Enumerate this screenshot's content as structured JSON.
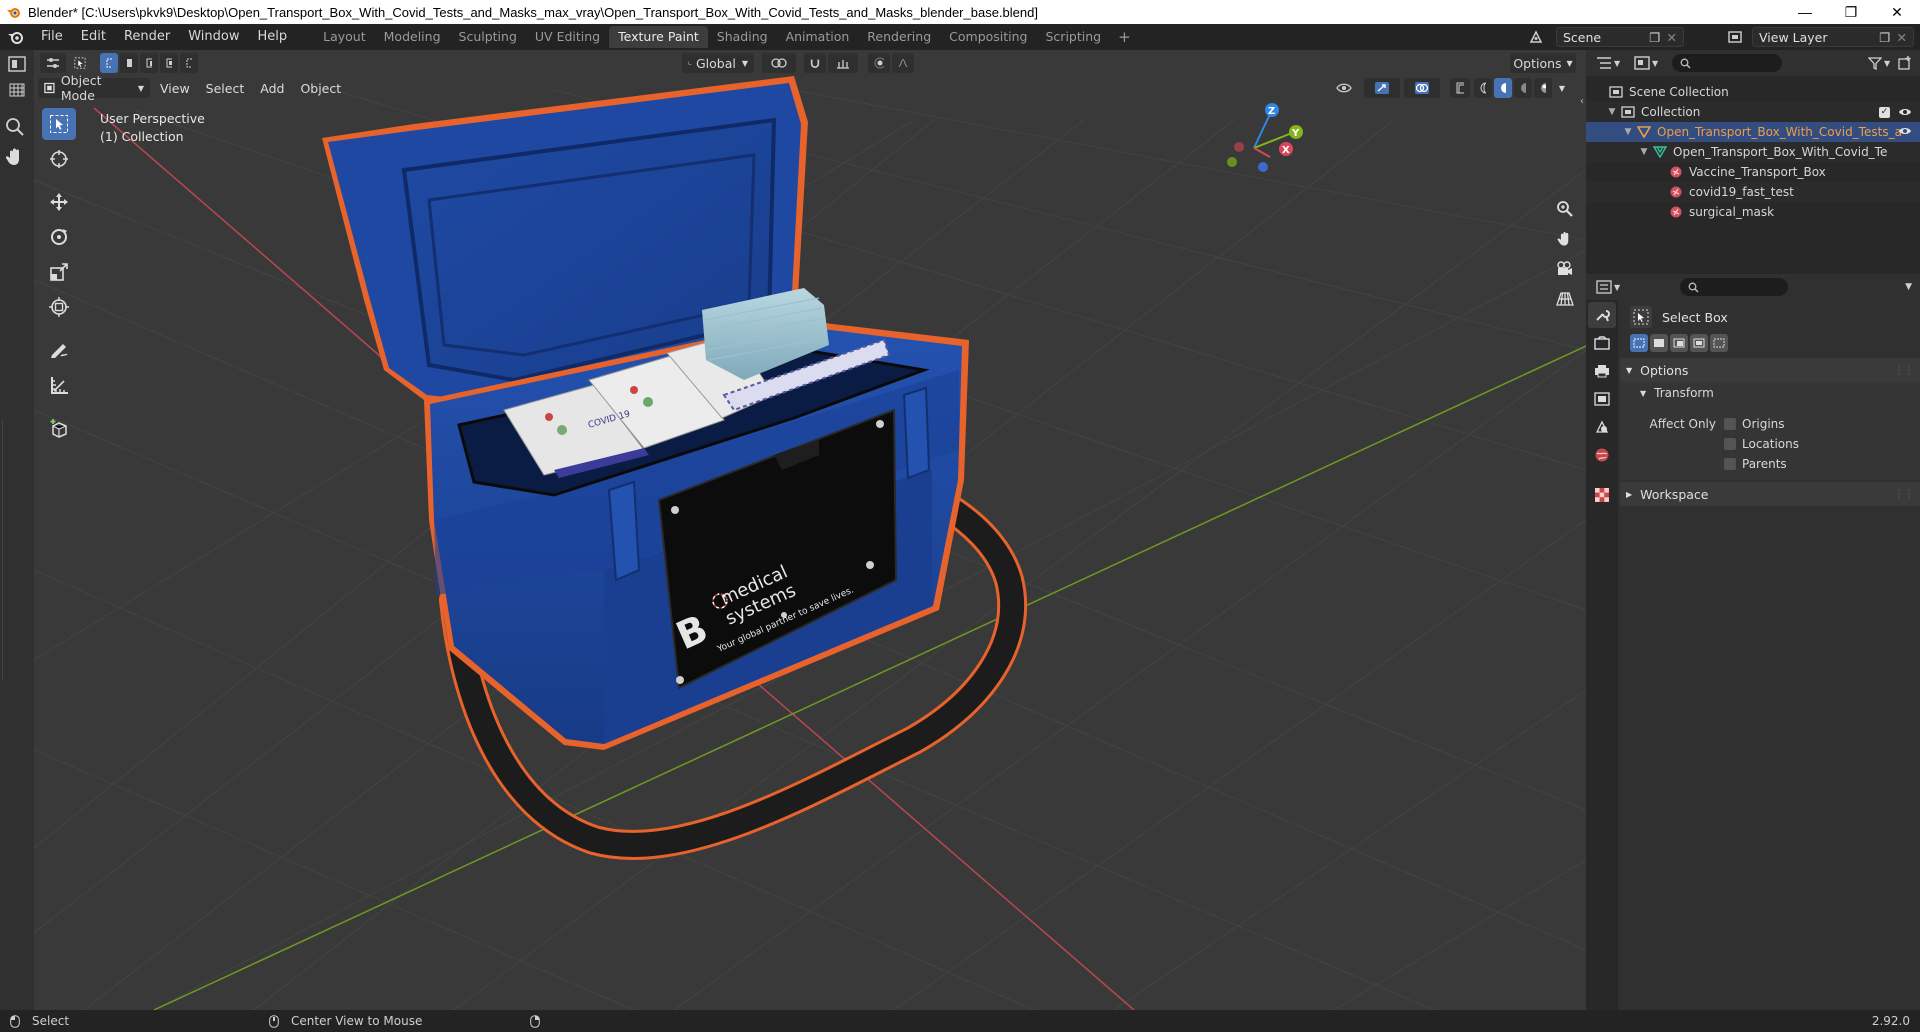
{
  "window": {
    "title": "Blender* [C:\\Users\\pkvk9\\Desktop\\Open_Transport_Box_With_Covid_Tests_and_Masks_max_vray\\Open_Transport_Box_With_Covid_Tests_and_Masks_blender_base.blend]"
  },
  "menu": [
    "File",
    "Edit",
    "Render",
    "Window",
    "Help"
  ],
  "workspaces": [
    {
      "label": "Layout",
      "active": false
    },
    {
      "label": "Modeling",
      "active": false
    },
    {
      "label": "Sculpting",
      "active": false
    },
    {
      "label": "UV Editing",
      "active": false
    },
    {
      "label": "Texture Paint",
      "active": true
    },
    {
      "label": "Shading",
      "active": false
    },
    {
      "label": "Animation",
      "active": false
    },
    {
      "label": "Rendering",
      "active": false
    },
    {
      "label": "Compositing",
      "active": false
    },
    {
      "label": "Scripting",
      "active": false
    }
  ],
  "scene": {
    "label": "Scene"
  },
  "view_layer": {
    "label": "View Layer"
  },
  "viewport": {
    "transform_orientation": "Global",
    "options_label": "Options",
    "mode": "Object Mode",
    "header_menus": [
      "View",
      "Select",
      "Add",
      "Object"
    ],
    "info_line1": "User Perspective",
    "info_line2": "(1) Collection",
    "gizmo": {
      "x": "X",
      "y": "Y",
      "z": "Z"
    }
  },
  "model": {
    "brand_letter": "B",
    "brand_line1": "medical",
    "brand_line2": "systems",
    "tagline": "Your global partner to save lives.",
    "kit_label": "COVID 19"
  },
  "outliner": {
    "scene_collection": "Scene Collection",
    "collection": "Collection",
    "items": [
      {
        "label": "Open_Transport_Box_With_Covid_Tests_a",
        "level": 2,
        "type": "empty"
      },
      {
        "label": "Open_Transport_Box_With_Covid_Te",
        "level": 3,
        "type": "mesh"
      },
      {
        "label": "Vaccine_Transport_Box",
        "level": 4,
        "type": "material"
      },
      {
        "label": "covid19_fast_test",
        "level": 4,
        "type": "material"
      },
      {
        "label": "surgical_mask",
        "level": 4,
        "type": "material"
      }
    ]
  },
  "properties": {
    "tool_name": "Select Box",
    "options_label": "Options",
    "transform_label": "Transform",
    "affect_only_label": "Affect Only",
    "affect_only": [
      "Origins",
      "Locations",
      "Parents"
    ],
    "workspace_label": "Workspace"
  },
  "status": {
    "left": "Select",
    "middle": "Center View to Mouse",
    "version": "2.92.0"
  },
  "colors": {
    "accent": "#4772b3",
    "selection_outline": "#e8632b",
    "box_blue": "#1e47a0",
    "x_axis": "#d8485c",
    "y_axis": "#84b51e",
    "z_axis": "#2f86e6"
  }
}
